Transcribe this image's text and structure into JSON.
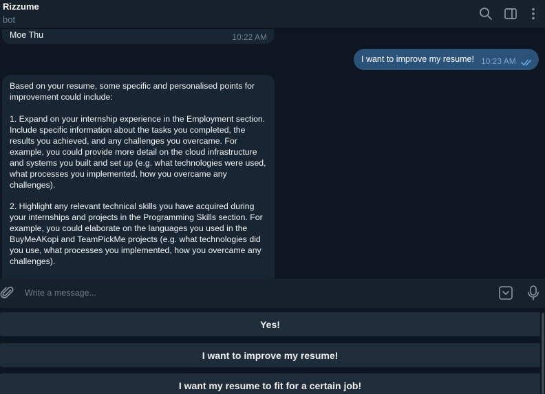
{
  "header": {
    "title": "Rizzume",
    "subtitle": "bot",
    "icons": [
      "search-icon",
      "sidebar-toggle-icon",
      "more-vertical-icon"
    ]
  },
  "messages": {
    "top_bubble": {
      "name": "Moe Thu",
      "time": "10:22 AM"
    },
    "outgoing": {
      "text": "I want to improve my resume!",
      "time": "10:23 AM",
      "status_icon": "double-check-icon"
    },
    "incoming_long": {
      "paragraphs": [
        "Based on your resume, some specific and personalised points for improvement could include:",
        "1. Expand on your internship experience in the Employment section. Include specific information about the tasks you completed, the results you achieved, and any challenges you overcame. For example, you could provide more detail on the cloud infrastructure and systems you built and set up (e.g. what technologies were used, what processes you implemented, how you overcame any challenges).",
        "2. Highlight any relevant technical skills you have acquired during your internships and projects in the Programming Skills section. For example, you could elaborate on the languages you used in the BuyMeAKopi and TeamPickMe projects (e.g. what technologies did you use, what processes you implemented, how you overcame any challenges)."
      ]
    }
  },
  "composer": {
    "placeholder": "Write a message...",
    "icons": [
      "paperclip-icon",
      "keyboard-toggle-icon",
      "microphone-icon"
    ]
  },
  "keyboard": {
    "buttons": [
      "Yes!",
      "I want to improve my resume!",
      "I want my resume to fit for a certain job!"
    ]
  },
  "colors": {
    "background": "#0e1621",
    "header": "#17212b",
    "incoming_bubble": "#182533",
    "outgoing_bubble": "#2b5278",
    "keyboard_button": "#1f2c39",
    "accent": "#6ab3f3"
  }
}
